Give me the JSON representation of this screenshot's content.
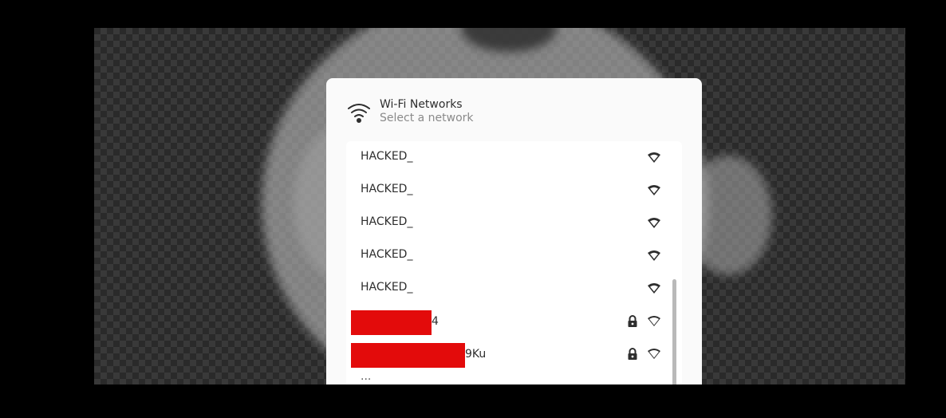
{
  "dialog": {
    "title": "Wi-Fi Networks",
    "subtitle": "Select a network",
    "header_icon": "wifi-icon"
  },
  "networks": [
    {
      "name": "HACKED_",
      "secured": false,
      "redacted": false,
      "signal": "full"
    },
    {
      "name": "HACKED_",
      "secured": false,
      "redacted": false,
      "signal": "full"
    },
    {
      "name": "HACKED_",
      "secured": false,
      "redacted": false,
      "signal": "full"
    },
    {
      "name": "HACKED_",
      "secured": false,
      "redacted": false,
      "signal": "full"
    },
    {
      "name": "HACKED_",
      "secured": false,
      "redacted": false,
      "signal": "full"
    },
    {
      "name": "4",
      "secured": true,
      "redacted": true,
      "signal": "partial"
    },
    {
      "name": "9Ku",
      "secured": true,
      "redacted": true,
      "signal": "partial"
    }
  ],
  "colors": {
    "redaction": "#e30b0b",
    "dialog_bg": "#fafafa",
    "list_bg": "#ffffff",
    "text": "#2e2e2e",
    "subtitle_text": "#8a8a8a"
  },
  "icons": {
    "lock": "lock-icon",
    "signal": "wifi-signal-icon"
  }
}
